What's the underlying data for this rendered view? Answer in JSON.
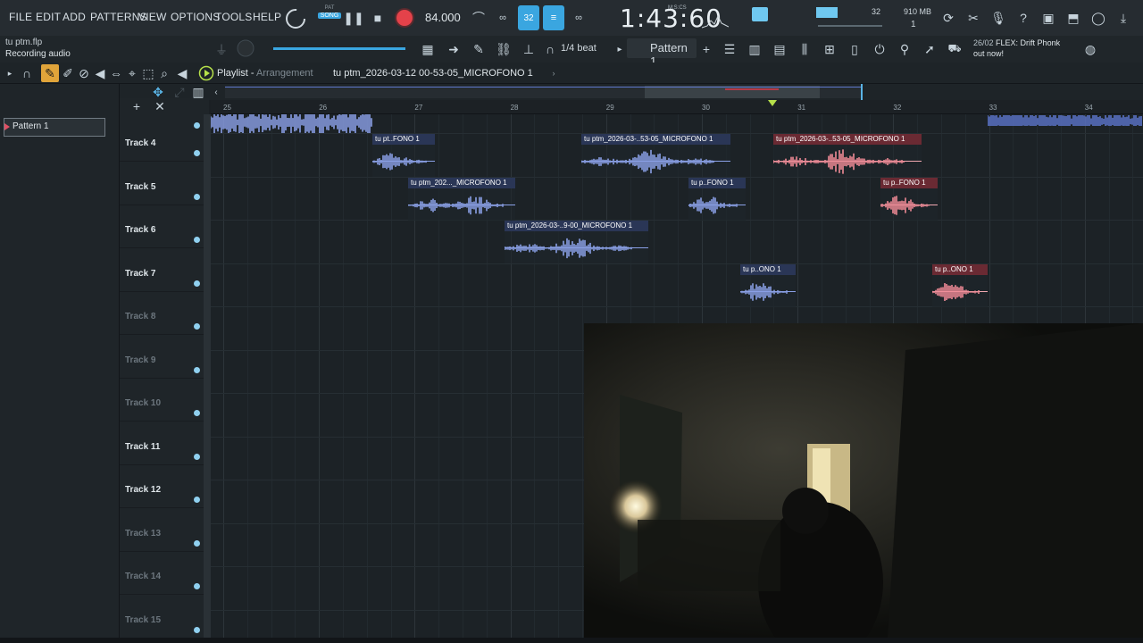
{
  "menu": [
    "FILE",
    "EDIT",
    "ADD",
    "PATTERNS",
    "VIEW",
    "OPTIONS",
    "TOOLS",
    "HELP"
  ],
  "transport": {
    "mode_pat": "PAT",
    "mode_song": "SONG",
    "bpm": "84.000",
    "clock": "1:43:60",
    "clock_label": "M:S:CS",
    "step_value": "32",
    "cpu_value": "32",
    "memory": "910 MB",
    "voices": "1"
  },
  "file": {
    "name": "tu ptm.flp",
    "status": "Recording audio"
  },
  "toolbar": {
    "snap": "1/4 beat",
    "pattern": "Pattern 1"
  },
  "news": {
    "date": "26/02",
    "text": "FLEX: Drift Phonk",
    "sub": "out now!"
  },
  "playlist": {
    "title": "Playlist",
    "subtitle": "Arrangement",
    "breadcrumb": "tu  ptm_2026-03-12 00-53-05_MICROFONO 1"
  },
  "browser": {
    "pattern_item": "Pattern 1"
  },
  "ruler": [
    "25",
    "26",
    "27",
    "28",
    "29",
    "30",
    "31",
    "32",
    "33",
    "34"
  ],
  "tracks": [
    "Track 4",
    "Track 5",
    "Track 6",
    "Track 7",
    "Track 8",
    "Track 9",
    "Track 10",
    "Track 11",
    "Track 12",
    "Track 13",
    "Track 14",
    "Track 15"
  ],
  "clips": [
    {
      "title": "tu  pt..FONO 1",
      "color": "blue"
    },
    {
      "title": "tu  ptm_2026-03-..53-05_MICROFONO 1",
      "color": "blue"
    },
    {
      "title": "tu  ptm_2026-03-..53-05_MICROFONO 1",
      "color": "red"
    },
    {
      "title": "tu  ptm_202..._MICROFONO 1",
      "color": "blue"
    },
    {
      "title": "tu  p..FONO 1",
      "color": "blue"
    },
    {
      "title": "tu  p..FONO 1",
      "color": "red"
    },
    {
      "title": "tu  ptm_2026-03-..9-00_MICROFONO 1",
      "color": "blue"
    },
    {
      "title": "tu  p..ONO 1",
      "color": "blue"
    },
    {
      "title": "tu  p..ONO 1",
      "color": "red"
    }
  ],
  "colors": {
    "accent": "#5ab4e6",
    "record": "#e4424a",
    "clip_blue": "#8aa0e6",
    "clip_red": "#f08a96"
  }
}
